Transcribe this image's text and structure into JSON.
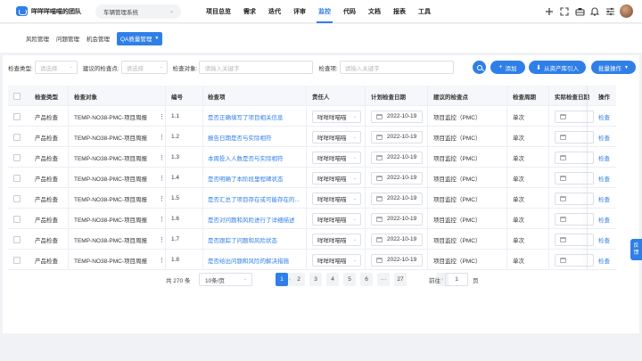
{
  "header": {
    "team_name": "咩咩咩喵喵的团队",
    "project": "车辆管理系统",
    "nav": [
      "项目总览",
      "需求",
      "迭代",
      "评审",
      "监控",
      "代码",
      "文档",
      "报表",
      "工具"
    ],
    "active_nav": "监控",
    "icons": [
      "plus-icon",
      "expand-icon",
      "briefcase-icon",
      "bell-icon",
      "settings-sliders-icon"
    ]
  },
  "subtabs": {
    "items": [
      "风险管理",
      "问题管理",
      "机会管理",
      "QA质量管理"
    ],
    "active": "QA质量管理"
  },
  "filters": {
    "type_label": "检查类型:",
    "type_placeholder": "请选择",
    "point_label": "建议的检查点:",
    "point_placeholder": "请选择",
    "object_label": "检查对象:",
    "object_placeholder": "请输入关键字",
    "item_label": "检查项:",
    "item_placeholder": "请输入关键字"
  },
  "actions": {
    "add": "添加",
    "import": "从资产库引入",
    "batch": "批量操作"
  },
  "table": {
    "headers": [
      "检查类型",
      "检查对象",
      "编号",
      "检查项",
      "责任人",
      "计划检查日期",
      "建议的检查点",
      "检查周期",
      "实际检查日期",
      "操作"
    ],
    "rows": [
      {
        "type": "产品检查",
        "object": "TEMP-NO38-PMC-项目周报",
        "no": "1.1",
        "item": "是否正确填写了项目相关信息",
        "owner": "咩咩咩喵喵",
        "plan_date": "2022-10-19",
        "point": "项目监控（PMC）",
        "cycle": "单次",
        "action": "检查"
      },
      {
        "type": "产品检查",
        "object": "TEMP-NO38-PMC-项目周报",
        "no": "1.2",
        "item": "报告日期是否与实际相符",
        "owner": "咩咩咩喵喵",
        "plan_date": "2022-10-19",
        "point": "项目监控（PMC）",
        "cycle": "单次",
        "action": "检查"
      },
      {
        "type": "产品检查",
        "object": "TEMP-NO38-PMC-项目周报",
        "no": "1.3",
        "item": "本周投入人数是否与实际相符",
        "owner": "咩咩咩喵喵",
        "plan_date": "2022-10-19",
        "point": "项目监控（PMC）",
        "cycle": "单次",
        "action": "检查"
      },
      {
        "type": "产品检查",
        "object": "TEMP-NO38-PMC-项目周报",
        "no": "1.4",
        "item": "是否明确了本阶段里程碑状态",
        "owner": "咩咩咩喵喵",
        "plan_date": "2022-10-19",
        "point": "项目监控（PMC）",
        "cycle": "单次",
        "action": "检查"
      },
      {
        "type": "产品检查",
        "object": "TEMP-NO38-PMC-项目周报",
        "no": "1.5",
        "item": "是否汇总了项目存在或可能存在的...",
        "owner": "咩咩咩喵喵",
        "plan_date": "2022-10-19",
        "point": "项目监控（PMC）",
        "cycle": "单次",
        "action": "检查"
      },
      {
        "type": "产品检查",
        "object": "TEMP-NO38-PMC-项目周报",
        "no": "1.6",
        "item": "是否对问题和风险进行了详细描述",
        "owner": "咩咩咩喵喵",
        "plan_date": "2022-10-19",
        "point": "项目监控（PMC）",
        "cycle": "单次",
        "action": "检查"
      },
      {
        "type": "产品检查",
        "object": "TEMP-NO38-PMC-项目周报",
        "no": "1.7",
        "item": "是否跟踪了问题和风险状态",
        "owner": "咩咩咩喵喵",
        "plan_date": "2022-10-19",
        "point": "项目监控（PMC）",
        "cycle": "单次",
        "action": "检查"
      },
      {
        "type": "产品检查",
        "object": "TEMP-NO38-PMC-项目周报",
        "no": "1.8",
        "item": "是否给出问题和风险的解决措施",
        "owner": "咩咩咩喵喵",
        "plan_date": "2022-10-19",
        "point": "项目监控（PMC）",
        "cycle": "单次",
        "action": "检查"
      }
    ]
  },
  "pagination": {
    "total": "共 270 条",
    "page_size": "10条/页",
    "pages": [
      "1",
      "2",
      "3",
      "4",
      "5",
      "6",
      "···",
      "27"
    ],
    "current": "1",
    "goto_label": "前往",
    "goto_value": "1",
    "goto_suffix": "页"
  },
  "side_tab": [
    "反",
    "馈"
  ],
  "colors": {
    "accent": "#2f7fe8",
    "background": "#f0f2f5"
  }
}
